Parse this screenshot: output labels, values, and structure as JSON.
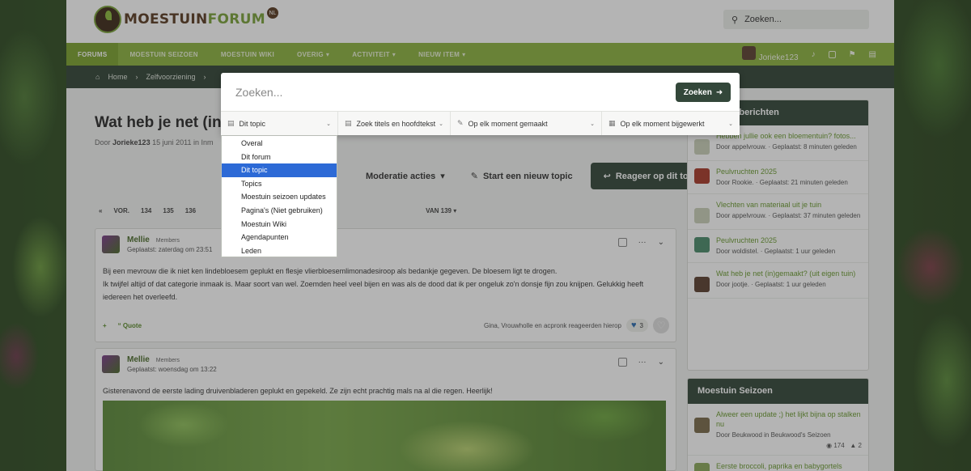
{
  "header": {
    "logo_main": "MOESTUIN",
    "logo_green": "FORUM",
    "logo_badge": "NL",
    "search_placeholder": "Zoeken..."
  },
  "nav": {
    "items": [
      "FORUMS",
      "MOESTUIN SEIZOEN",
      "MOESTUIN WIKI",
      "OVERIG",
      "ACTIVITEIT",
      "NIEUW ITEM"
    ],
    "username": "Jorieke123"
  },
  "breadcrumb": [
    "Home",
    "Zelfvoorziening"
  ],
  "thread": {
    "title": "Wat heb je net (in)",
    "by_prefix": "Door",
    "author": "Jorieke123",
    "date": "15 juni 2011",
    "forum_prefix": "in Inm"
  },
  "actions": {
    "moderation": "Moderatie acties",
    "start_topic": "Start een nieuw topic",
    "reply": "Reageer op dit topic"
  },
  "pager": {
    "prev": "VOR.",
    "pages": [
      "134",
      "135",
      "136"
    ],
    "of_label": "VAN 139"
  },
  "posts": [
    {
      "author": "Mellie",
      "role": "Members",
      "date": "Geplaatst: zaterdag om 23:51",
      "lines": [
        "Bij een mevrouw die ik niet ken lindebloesem geplukt en flesje vlierbloesemlimonadesiroop als bedankje gegeven. De bloesem ligt te drogen.",
        "Ik twijfel altijd of dat categorie inmaak is. Maar soort van wel. Zoemden heel veel bijen en was als de dood dat ik per ongeluk zo'n donsje fijn zou knijpen. Gelukkig heeft iedereen het overleefd."
      ],
      "quote_label": "Quote",
      "reactions_text": "Gina, Vrouwholle en acpronk reageerden hierop",
      "reaction_count": "3"
    },
    {
      "author": "Mellie",
      "role": "Members",
      "date": "Geplaatst: woensdag om 13:22",
      "lines": [
        "Gisterenavond de eerste lading druivenbladeren geplukt en gepekeld. Ze zijn echt prachtig mals na al die regen. Heerlijk!"
      ]
    }
  ],
  "sidebar_latest": {
    "title": "Nieuwste berichten",
    "items": [
      {
        "title": "Hebben jullie ook een bloementuin? fotos...",
        "meta": "Door appelvrouw. · Geplaatst: 8 minuten geleden"
      },
      {
        "title": "Peulvruchten 2025",
        "meta": "Door Rookie. · Geplaatst: 21 minuten geleden"
      },
      {
        "title": "Vlechten van materiaal uit je tuin",
        "meta": "Door appelvrouw. · Geplaatst: 37 minuten geleden"
      },
      {
        "title": "Peulvruchten 2025",
        "meta": "Door woldistel. · Geplaatst: 1 uur geleden"
      },
      {
        "title": "Wat heb je net (in)gemaakt? (uit eigen tuin)",
        "meta": "Door jootje. · Geplaatst: 1 uur geleden"
      }
    ]
  },
  "sidebar_season": {
    "title": "Moestuin Seizoen",
    "items": [
      {
        "title": "Alweer een update ;) het lijkt bijna op stalken nu",
        "meta": "Door Beukwood in Beukwood's Seizoen",
        "views": "174",
        "comments": "2"
      },
      {
        "title": "Eerste broccoli, paprika en babygortels",
        "meta": ""
      }
    ]
  },
  "search_modal": {
    "placeholder": "Zoeken...",
    "button": "Zoeken",
    "filters": [
      "Dit topic",
      "Zoek titels en hoofdtekst",
      "Op elk moment gemaakt",
      "Op elk moment bijgewerkt"
    ],
    "dropdown_options": [
      "Overal",
      "Dit forum",
      "Dit topic",
      "Topics",
      "Moestuin seizoen updates",
      "Pagina's (Niet gebruiken)",
      "Moestuin Wiki",
      "Agendapunten",
      "Leden"
    ],
    "selected": "Dit topic"
  },
  "colors": {
    "nav_green": "#8db33f",
    "dark_green": "#33473a",
    "select_blue": "#2d6ad6"
  }
}
